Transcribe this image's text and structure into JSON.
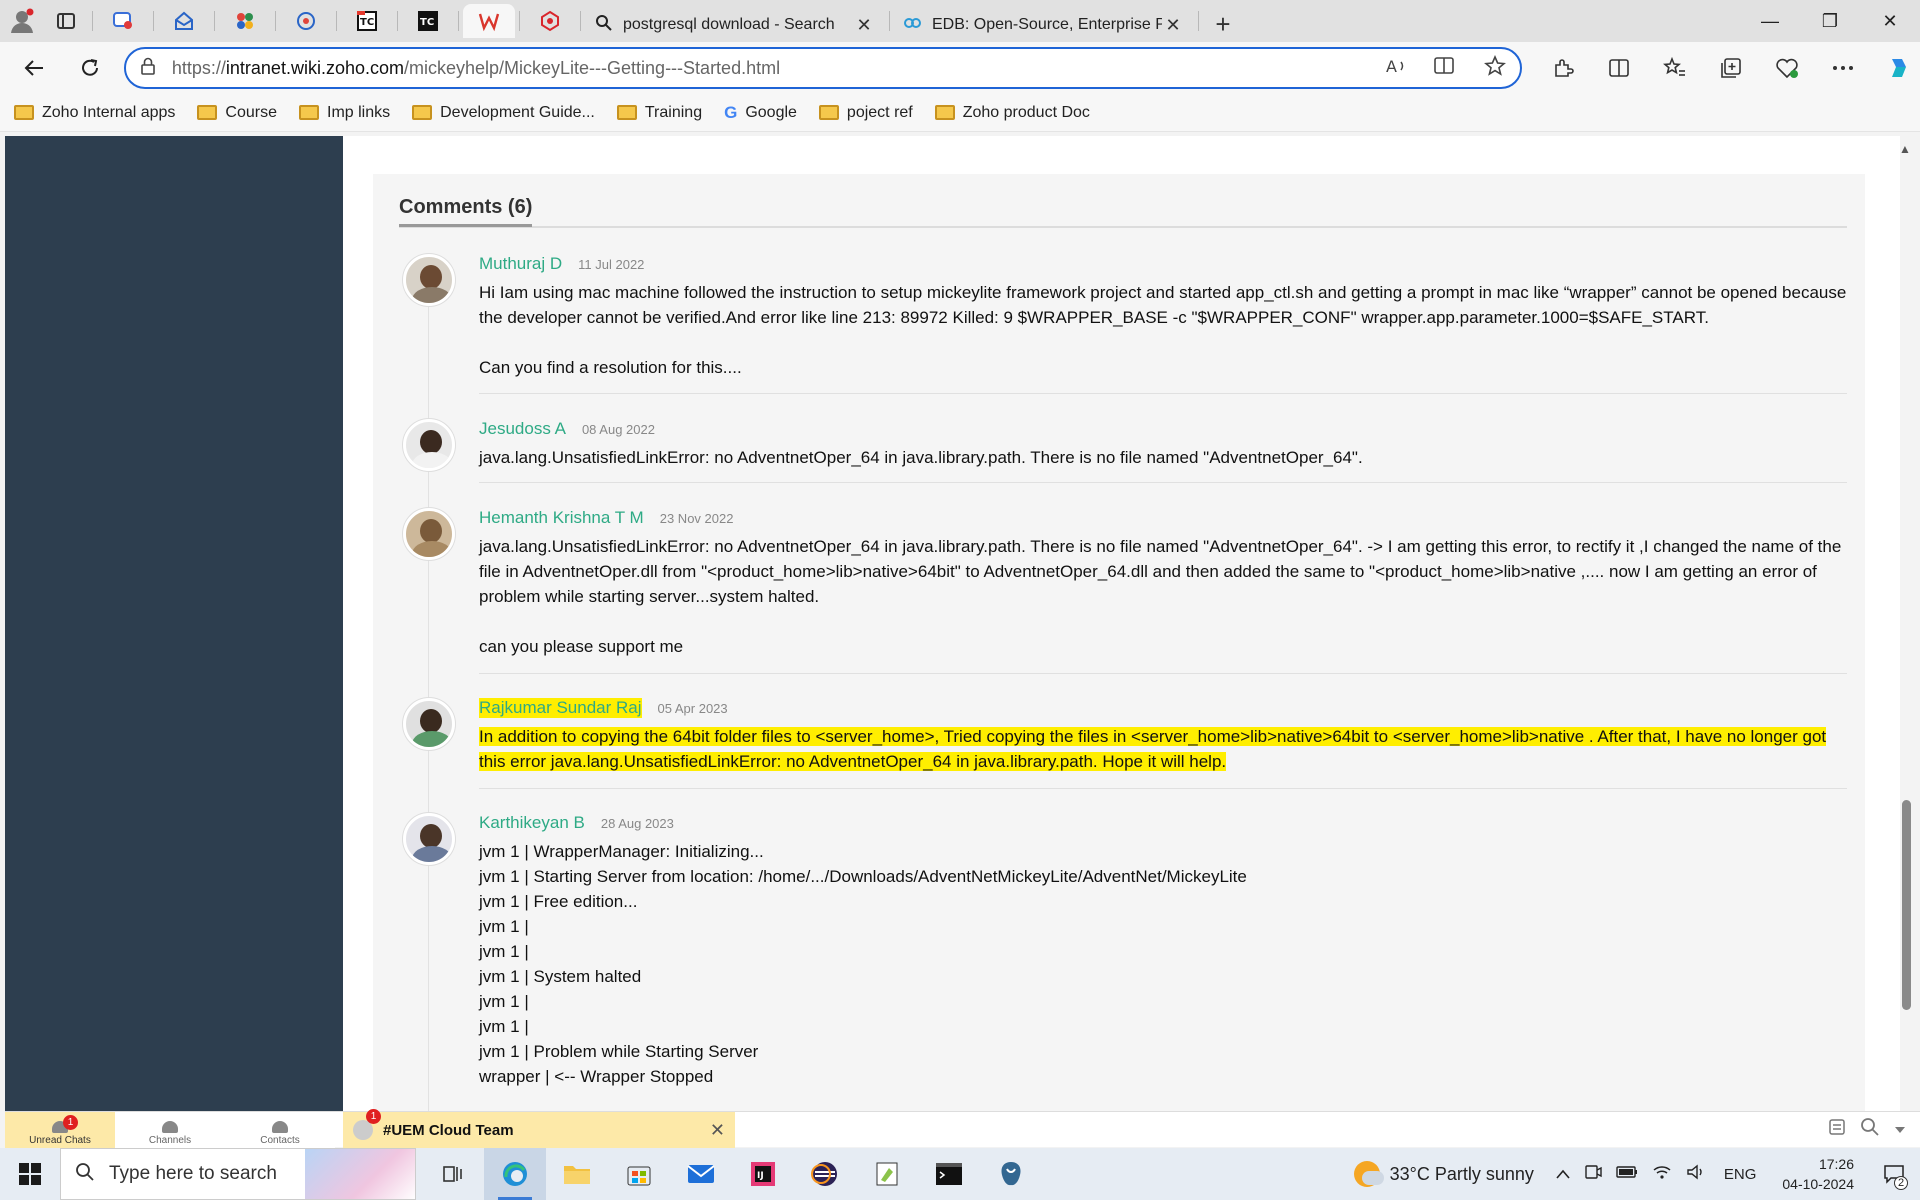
{
  "browser": {
    "tabs": [
      {
        "title": "postgresql download - Search",
        "icon": "search-icon"
      },
      {
        "title": "EDB: Open-Source, Enterprise Pos",
        "icon": "edb-icon"
      }
    ],
    "url_prefix": "https://",
    "url_host": "intranet.wiki.zoho.com",
    "url_path": "/mickeyhelp/MickeyLite---Getting---Started.html"
  },
  "bookmarks": [
    {
      "label": "Zoho Internal apps",
      "type": "folder"
    },
    {
      "label": "Course",
      "type": "folder"
    },
    {
      "label": "Imp links",
      "type": "folder"
    },
    {
      "label": "Development Guide...",
      "type": "folder"
    },
    {
      "label": "Training",
      "type": "folder"
    },
    {
      "label": "Google",
      "type": "google"
    },
    {
      "label": "poject ref",
      "type": "folder"
    },
    {
      "label": "Zoho product Doc",
      "type": "folder"
    }
  ],
  "comments_section": {
    "title": "Comments (6)",
    "comments": [
      {
        "author": "Muthuraj D",
        "date": "11 Jul 2022",
        "paragraphs": [
          "Hi Iam using mac machine followed the instruction to setup mickeylite framework project and started app_ctl.sh and getting a prompt in mac like “wrapper” cannot be opened because the developer cannot be verified.And error like line 213: 89972 Killed: 9 $WRAPPER_BASE -c \"$WRAPPER_CONF\" wrapper.app.parameter.1000=$SAFE_START.",
          "",
          "Can you find a resolution for this...."
        ]
      },
      {
        "author": "Jesudoss A",
        "date": "08 Aug 2022",
        "paragraphs": [
          "java.lang.UnsatisfiedLinkError: no AdventnetOper_64 in java.library.path. There is no file named \"AdventnetOper_64\"."
        ]
      },
      {
        "author": "Hemanth Krishna T M",
        "date": "23 Nov 2022",
        "paragraphs": [
          "java.lang.UnsatisfiedLinkError: no AdventnetOper_64 in java.library.path. There is no file named \"AdventnetOper_64\". -> I am getting this error, to rectify it ,I changed the name of the file in AdventnetOper.dll from \"<product_home>lib>native>64bit\" to AdventnetOper_64.dll and then added the same to \"<product_home>lib>native ,.... now I am getting an error of problem while starting server...system halted.",
          "",
          "can you please support me"
        ]
      },
      {
        "author": "Rajkumar Sundar Raj",
        "date": "05 Apr 2023",
        "highlighted": true,
        "paragraphs": [
          "In addition to copying the 64bit folder files to <server_home>, Tried copying the files in <server_home>lib>native>64bit to <server_home>lib>native . After that, I have no longer got this error java.lang.UnsatisfiedLinkError: no AdventnetOper_64 in java.library.path. Hope it will help."
        ]
      },
      {
        "author": "Karthikeyan B",
        "date": "28 Aug 2023",
        "paragraphs": [
          "jvm 1 | WrapperManager: Initializing...",
          "jvm 1 | Starting Server from location: /home/.../Downloads/AdventNetMickeyLite/AdventNet/MickeyLite",
          "jvm 1 | Free edition...",
          "jvm 1 |",
          "jvm 1 |",
          "jvm 1 | System halted",
          "jvm 1 |",
          "jvm 1 |",
          "jvm 1 | Problem while Starting Server",
          "wrapper | <-- Wrapper Stopped"
        ]
      }
    ]
  },
  "chat": {
    "tabs": [
      {
        "label": "Unread Chats",
        "badge": "1"
      },
      {
        "label": "Channels"
      },
      {
        "label": "Contacts"
      }
    ],
    "open_chat": {
      "title": "#UEM Cloud Team",
      "badge": "1"
    }
  },
  "taskbar": {
    "search_placeholder": "Type here to search",
    "weather": "33°C  Partly sunny",
    "language": "ENG",
    "time": "17:26",
    "date": "04-10-2024",
    "notification_count": "2"
  },
  "colors": {
    "accent": "#1f64d6",
    "author_green": "#2eaa85",
    "highlight": "#ffee00",
    "sidebar": "#2d3e4f"
  }
}
